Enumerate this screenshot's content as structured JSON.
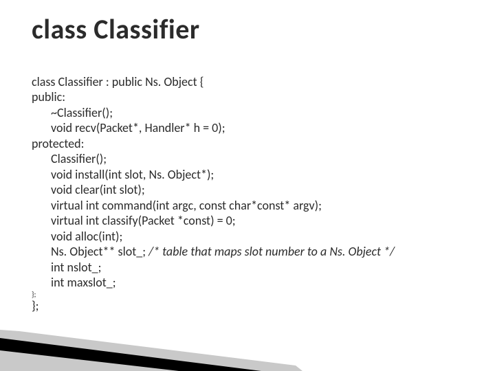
{
  "title": "class Classifier",
  "code": {
    "l1": "class Classifier : public Ns. Object {",
    "l2": "public:",
    "l3": "~Classifier();",
    "l4": "void recv(Packet*, Handler* h = 0);",
    "l5": "protected:",
    "l6": "Classifier();",
    "l7": "void install(int slot, Ns. Object*);",
    "l8": "void clear(int slot);",
    "l9": "virtual int command(int argc, const char*const* argv);",
    "l10": "virtual int classify(Packet *const) = 0;",
    "l11": "void alloc(int);",
    "l12_a": "Ns. Object** slot_; ",
    "l12_b": "/* table that maps slot number to a Ns. Object */",
    "l13": "int nslot_;",
    "l14": "int maxslot_;",
    "l15": "};",
    "l16": "};"
  }
}
